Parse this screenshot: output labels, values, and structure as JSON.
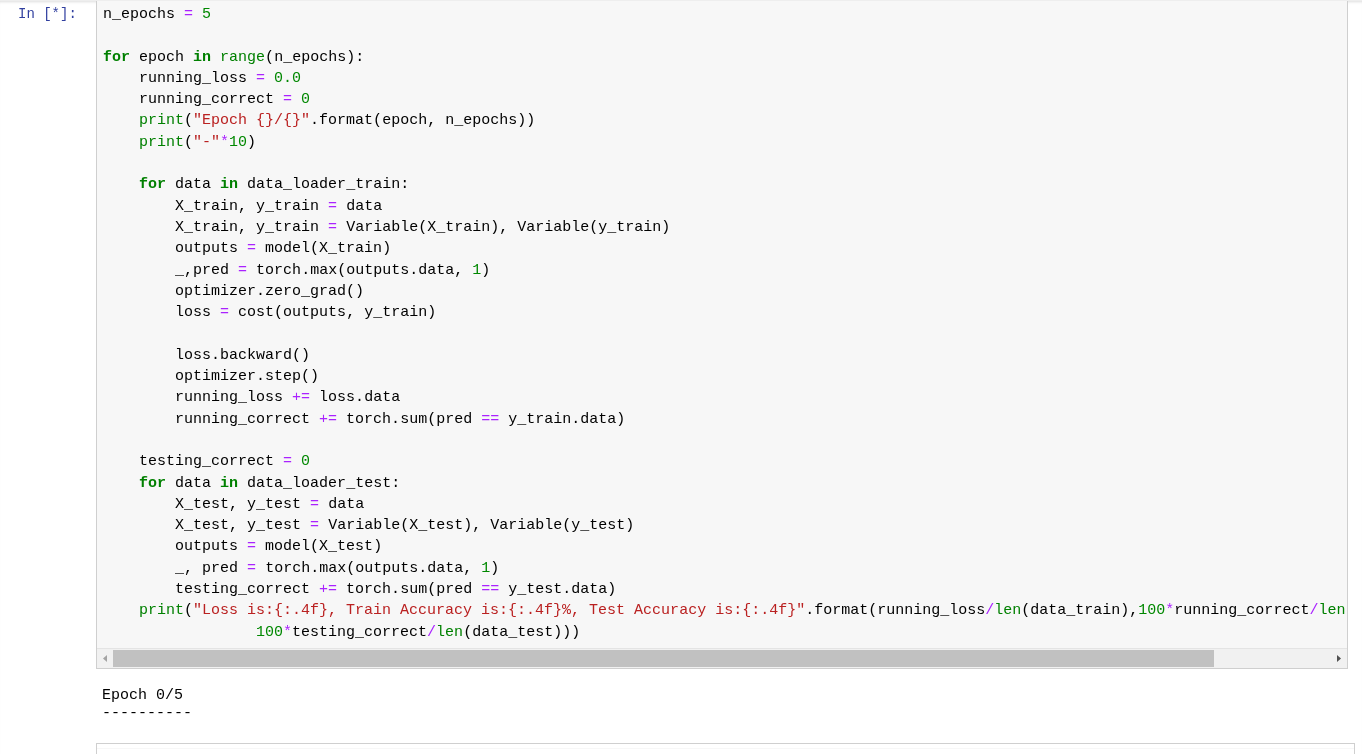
{
  "cell": {
    "prompt": "In [*]:",
    "lines": [
      {
        "kind": "code",
        "text": "n_epochs = 5"
      },
      {
        "kind": "blank"
      },
      {
        "kind": "code",
        "text": "for epoch in range(n_epochs):"
      },
      {
        "kind": "code",
        "text": "    running_loss = 0.0"
      },
      {
        "kind": "code",
        "text": "    running_correct = 0"
      },
      {
        "kind": "code",
        "text": "    print(\"Epoch {}/{}\".format(epoch, n_epochs))"
      },
      {
        "kind": "code",
        "text": "    print(\"-\"*10)"
      },
      {
        "kind": "blank"
      },
      {
        "kind": "code",
        "text": "    for data in data_loader_train:"
      },
      {
        "kind": "code",
        "text": "        X_train, y_train = data"
      },
      {
        "kind": "code",
        "text": "        X_train, y_train = Variable(X_train), Variable(y_train)"
      },
      {
        "kind": "code",
        "text": "        outputs = model(X_train)"
      },
      {
        "kind": "code",
        "text": "        _,pred = torch.max(outputs.data, 1)"
      },
      {
        "kind": "code",
        "text": "        optimizer.zero_grad()"
      },
      {
        "kind": "code",
        "text": "        loss = cost(outputs, y_train)"
      },
      {
        "kind": "blank"
      },
      {
        "kind": "code",
        "text": "        loss.backward()"
      },
      {
        "kind": "code",
        "text": "        optimizer.step()"
      },
      {
        "kind": "code",
        "text": "        running_loss += loss.data"
      },
      {
        "kind": "code",
        "text": "        running_correct += torch.sum(pred == y_train.data)"
      },
      {
        "kind": "blank"
      },
      {
        "kind": "code",
        "text": "    testing_correct = 0"
      },
      {
        "kind": "code",
        "text": "    for data in data_loader_test:"
      },
      {
        "kind": "code",
        "text": "        X_test, y_test = data"
      },
      {
        "kind": "code",
        "text": "        X_test, y_test = Variable(X_test), Variable(y_test)"
      },
      {
        "kind": "code",
        "text": "        outputs = model(X_test)"
      },
      {
        "kind": "code",
        "text": "        _, pred = torch.max(outputs.data, 1)"
      },
      {
        "kind": "code",
        "text": "        testing_correct += torch.sum(pred == y_test.data)"
      },
      {
        "kind": "code",
        "text": "    print(\"Loss is:{:.4f}, Train Accuracy is:{:.4f}%, Test Accuracy is:{:.4f}\".format(running_loss/len(data_train),100*running_correct/len"
      },
      {
        "kind": "code",
        "text": "                 100*testing_correct/len(data_test)))"
      }
    ],
    "output": [
      "Epoch 0/5",
      "----------"
    ]
  }
}
